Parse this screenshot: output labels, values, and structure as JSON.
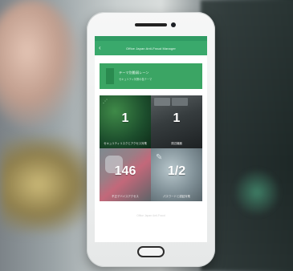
{
  "appbar": {
    "title": "Office Japan Anti-Fraud Manager"
  },
  "banner": {
    "title": "テーマ別脆弱レーン",
    "subtitle": "セキュリティ対策の各テーマ"
  },
  "tiles": [
    {
      "number": "1",
      "caption": "セキュリティリスクとアクセス対策",
      "icon": "network-icon"
    },
    {
      "number": "1",
      "caption": "周辺機器",
      "icon": "keyboard-icon"
    },
    {
      "number": "146",
      "caption": "不正デバイスアクセス",
      "icon": "hand-phone-icon"
    },
    {
      "number": "1/2",
      "caption": "パスワードと認証対策",
      "icon": "pencil-icon"
    }
  ],
  "footer": {
    "text": "Office Japan Anti-Fraud"
  },
  "colors": {
    "accent": "#3aa96c",
    "statusbar": "#2f9b63"
  }
}
